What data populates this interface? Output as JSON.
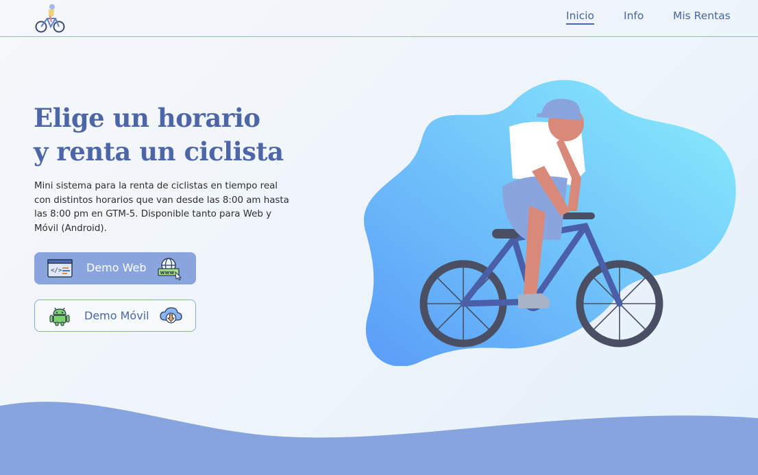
{
  "nav": {
    "links": [
      {
        "label": "Inicio",
        "active": true
      },
      {
        "label": "Info",
        "active": false
      },
      {
        "label": "Mis Rentas",
        "active": false
      }
    ]
  },
  "hero": {
    "title_line1": "Elige un horario",
    "title_line2": "y renta un ciclista",
    "description": "Mini sistema para la renta de ciclistas en tiempo real con distintos horarios que van desde las 8:00 am hasta las 8:00 pm en GTM-5. Disponible tanto para Web y Móvil (Android)."
  },
  "buttons": {
    "web": {
      "label": "Demo Web",
      "icon_left": "code-window-icon",
      "icon_right": "www-globe-icon"
    },
    "movil": {
      "label": "Demo Móvil",
      "icon_left": "android-icon",
      "icon_right": "cloud-download-icon"
    }
  },
  "colors": {
    "primary": "#4a64a6",
    "button_fill": "#8aa5de",
    "wave": "#87a4de",
    "blob_start": "#5a9cf8",
    "blob_end": "#8aeefc"
  }
}
